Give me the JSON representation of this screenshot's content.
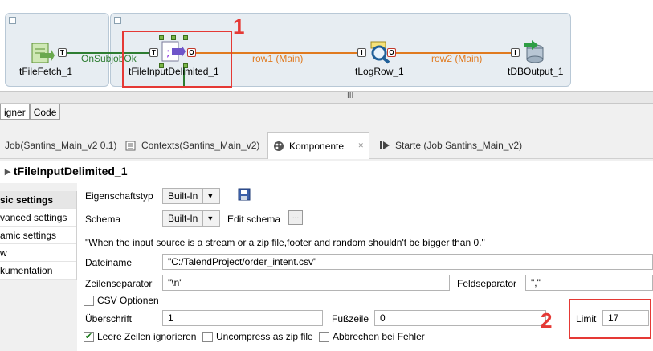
{
  "canvas": {
    "components": {
      "fetch": "tFileFetch_1",
      "input": "tFileInputDelimited_1",
      "log": "tLogRow_1",
      "output": "tDBOutput_1"
    },
    "connections": {
      "subjob_ok": "OnSubjobOk",
      "row1": "row1 (Main)",
      "row2": "row2 (Main)"
    },
    "annotations": {
      "one": "1",
      "two": "2"
    },
    "splitter_grip": "III"
  },
  "design_tabs": [
    "igner",
    "Code"
  ],
  "view_tabs": {
    "job": "Job(Santins_Main_v2 0.1)",
    "contexts": "Contexts(Santins_Main_v2)",
    "komponente": "Komponente",
    "starte": "Starte (Job Santins_Main_v2)",
    "close": "✕"
  },
  "component_title": "tFileInputDelimited_1",
  "nav": [
    {
      "label": "sic settings",
      "selected": true
    },
    {
      "label": "vanced settings",
      "selected": false
    },
    {
      "label": "amic settings",
      "selected": false
    },
    {
      "label": "w",
      "selected": false
    },
    {
      "label": "kumentation",
      "selected": false
    }
  ],
  "form": {
    "eigenschaftstyp_label": "Eigenschaftstyp",
    "eigenschaftstyp_value": "Built-In",
    "schema_label": "Schema",
    "schema_value": "Built-In",
    "edit_schema": "Edit schema",
    "edit_btn": "...",
    "note": "\"When the input source is a stream or a zip file,footer and random shouldn't be bigger than 0.\"",
    "dateiname_label": "Dateiname",
    "dateiname_value": "\"C:/TalendProject/order_intent.csv\"",
    "zeilenseparator_label": "Zeilenseparator",
    "zeilenseparator_value": "\"\\n\"",
    "feldseparator_label": "Feldseparator",
    "feldseparator_value": "\",\"",
    "csv_label": "CSV Optionen",
    "ueberschrift_label": "Überschrift",
    "ueberschrift_value": "1",
    "fusszeile_label": "Fußzeile",
    "fusszeile_value": "0",
    "limit_label": "Limit",
    "limit_value": "17",
    "leere_label": "Leere Zeilen ignorieren",
    "uncompress_label": "Uncompress as zip file",
    "abbrechen_label": "Abbrechen bei Fehler",
    "checkmark": "✔"
  },
  "colors": {
    "accent_red": "#e53935",
    "main_connection": "#e07a1f",
    "ok_connection": "#2e7d32",
    "subjob_bg": "#e7edf2"
  }
}
